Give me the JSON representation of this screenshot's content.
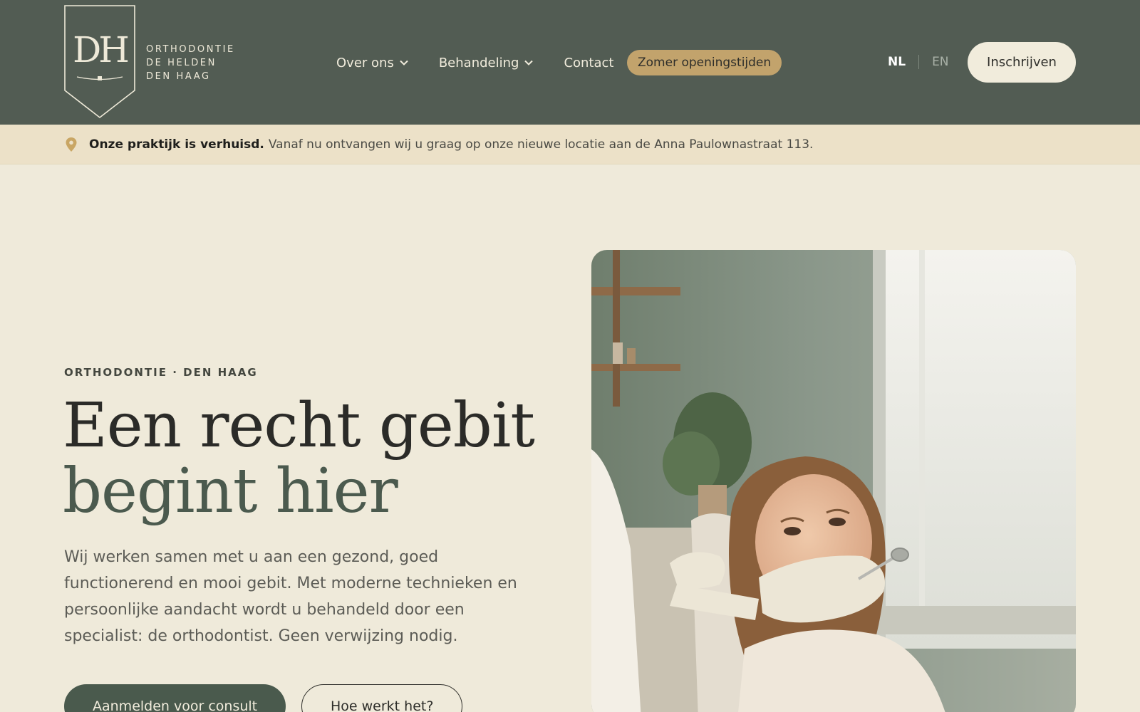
{
  "brand": {
    "monogram": "DH",
    "name_lines": [
      "ORTHODONTIE",
      "DE HELDEN",
      "DEN HAAG"
    ]
  },
  "nav": {
    "items": [
      {
        "label": "Over ons",
        "has_dropdown": true
      },
      {
        "label": "Behandeling",
        "has_dropdown": true
      },
      {
        "label": "Contact",
        "has_dropdown": false
      }
    ],
    "highlight": "Zomer openingstijden",
    "lang_active": "NL",
    "lang_other": "EN",
    "signup": "Inschrijven"
  },
  "notice": {
    "icon": "location-pin-icon",
    "strong": "Onze praktijk is verhuisd.",
    "text": "Vanaf nu ontvangen wij u graag op onze nieuwe locatie aan de Anna Paulownastraat 113."
  },
  "hero": {
    "eyebrow": "ORTHODONTIE · DEN HAAG",
    "title_line1": "Een recht gebit",
    "title_line2": "begint hier",
    "lead": "Wij werken samen met u aan een gezond, goed functionerend en mooi gebit. Met moderne technieken en persoonlijke aandacht wordt u behandeld door een specialist: de orthodontist. Geen verwijzing nodig.",
    "primary_cta": "Aanmelden voor consult",
    "secondary_cta": "Hoe werkt het?"
  },
  "colors": {
    "header_bg": "#525c53",
    "page_bg": "#efeada",
    "notice_bg": "#ece1c8",
    "accent_gold": "#c2a36c",
    "primary_green": "#4a5a4d"
  }
}
